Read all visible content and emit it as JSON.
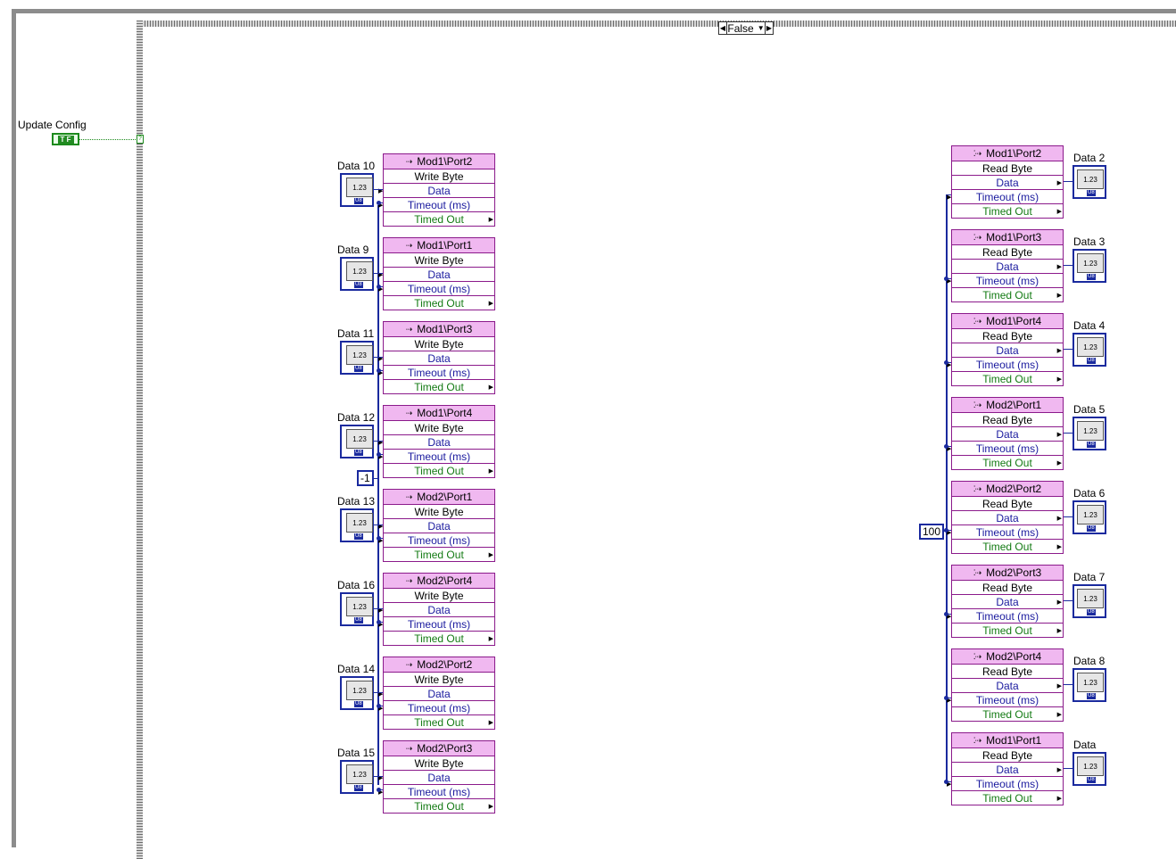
{
  "case_structure": {
    "selector_value": "False"
  },
  "update_config": {
    "label": "Update Config",
    "bool_glyph": "T F",
    "tunnel_glyph": "?"
  },
  "constants": {
    "timeout_write": "-1",
    "timeout_read": "100"
  },
  "write_nodes": [
    {
      "port": "Mod1\\Port2",
      "op": "Write Byte",
      "data": "Data",
      "timeout": "Timeout (ms)",
      "timed_out": "Timed Out",
      "control_label": "Data 10"
    },
    {
      "port": "Mod1\\Port1",
      "op": "Write Byte",
      "data": "Data",
      "timeout": "Timeout (ms)",
      "timed_out": "Timed Out",
      "control_label": "Data 9"
    },
    {
      "port": "Mod1\\Port3",
      "op": "Write Byte",
      "data": "Data",
      "timeout": "Timeout (ms)",
      "timed_out": "Timed Out",
      "control_label": "Data 11"
    },
    {
      "port": "Mod1\\Port4",
      "op": "Write Byte",
      "data": "Data",
      "timeout": "Timeout (ms)",
      "timed_out": "Timed Out",
      "control_label": "Data 12"
    },
    {
      "port": "Mod2\\Port1",
      "op": "Write Byte",
      "data": "Data",
      "timeout": "Timeout (ms)",
      "timed_out": "Timed Out",
      "control_label": "Data 13"
    },
    {
      "port": "Mod2\\Port4",
      "op": "Write Byte",
      "data": "Data",
      "timeout": "Timeout (ms)",
      "timed_out": "Timed Out",
      "control_label": "Data 16"
    },
    {
      "port": "Mod2\\Port2",
      "op": "Write Byte",
      "data": "Data",
      "timeout": "Timeout (ms)",
      "timed_out": "Timed Out",
      "control_label": "Data 14"
    },
    {
      "port": "Mod2\\Port3",
      "op": "Write Byte",
      "data": "Data",
      "timeout": "Timeout (ms)",
      "timed_out": "Timed Out",
      "control_label": "Data 15"
    }
  ],
  "read_nodes": [
    {
      "port": "Mod1\\Port2",
      "op": "Read Byte",
      "data": "Data",
      "timeout": "Timeout (ms)",
      "timed_out": "Timed Out",
      "indicator_label": "Data 2"
    },
    {
      "port": "Mod1\\Port3",
      "op": "Read Byte",
      "data": "Data",
      "timeout": "Timeout (ms)",
      "timed_out": "Timed Out",
      "indicator_label": "Data 3"
    },
    {
      "port": "Mod1\\Port4",
      "op": "Read Byte",
      "data": "Data",
      "timeout": "Timeout (ms)",
      "timed_out": "Timed Out",
      "indicator_label": "Data 4"
    },
    {
      "port": "Mod2\\Port1",
      "op": "Read Byte",
      "data": "Data",
      "timeout": "Timeout (ms)",
      "timed_out": "Timed Out",
      "indicator_label": "Data 5"
    },
    {
      "port": "Mod2\\Port2",
      "op": "Read Byte",
      "data": "Data",
      "timeout": "Timeout (ms)",
      "timed_out": "Timed Out",
      "indicator_label": "Data 6"
    },
    {
      "port": "Mod2\\Port3",
      "op": "Read Byte",
      "data": "Data",
      "timeout": "Timeout (ms)",
      "timed_out": "Timed Out",
      "indicator_label": "Data 7"
    },
    {
      "port": "Mod2\\Port4",
      "op": "Read Byte",
      "data": "Data",
      "timeout": "Timeout (ms)",
      "timed_out": "Timed Out",
      "indicator_label": "Data 8"
    },
    {
      "port": "Mod1\\Port1",
      "op": "Read Byte",
      "data": "Data",
      "timeout": "Timeout (ms)",
      "timed_out": "Timed Out",
      "indicator_label": "Data"
    }
  ],
  "numeric_glyph": "1.23",
  "type_badge": "U8",
  "colors": {
    "wire_blue": "#1a2a9e",
    "node_header": "#f0b8f0",
    "node_border": "#8b1a8b",
    "bool_green": "#1c8a1c"
  }
}
